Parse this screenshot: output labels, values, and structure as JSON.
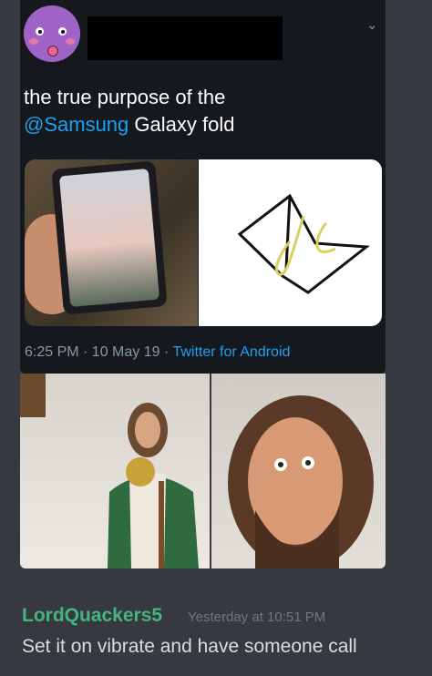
{
  "tweet": {
    "text_prefix": "the true purpose of the",
    "mention": "@Samsung",
    "text_suffix": " Galaxy fold",
    "time": "6:25 PM · 10 May 19 · ",
    "source": "Twitter for Android",
    "colors": {
      "link": "#1da1f2",
      "card_bg": "#15181d",
      "meta": "#8899a6"
    }
  },
  "icons": {
    "menu": "chevron-down-icon"
  },
  "message": {
    "author": "LordQuackers5",
    "timestamp": "Yesterday at 10:51 PM",
    "text": "Set it on vibrate and have someone call",
    "colors": {
      "author": "#43b581",
      "text": "#dcddde",
      "bg": "#363940"
    }
  }
}
